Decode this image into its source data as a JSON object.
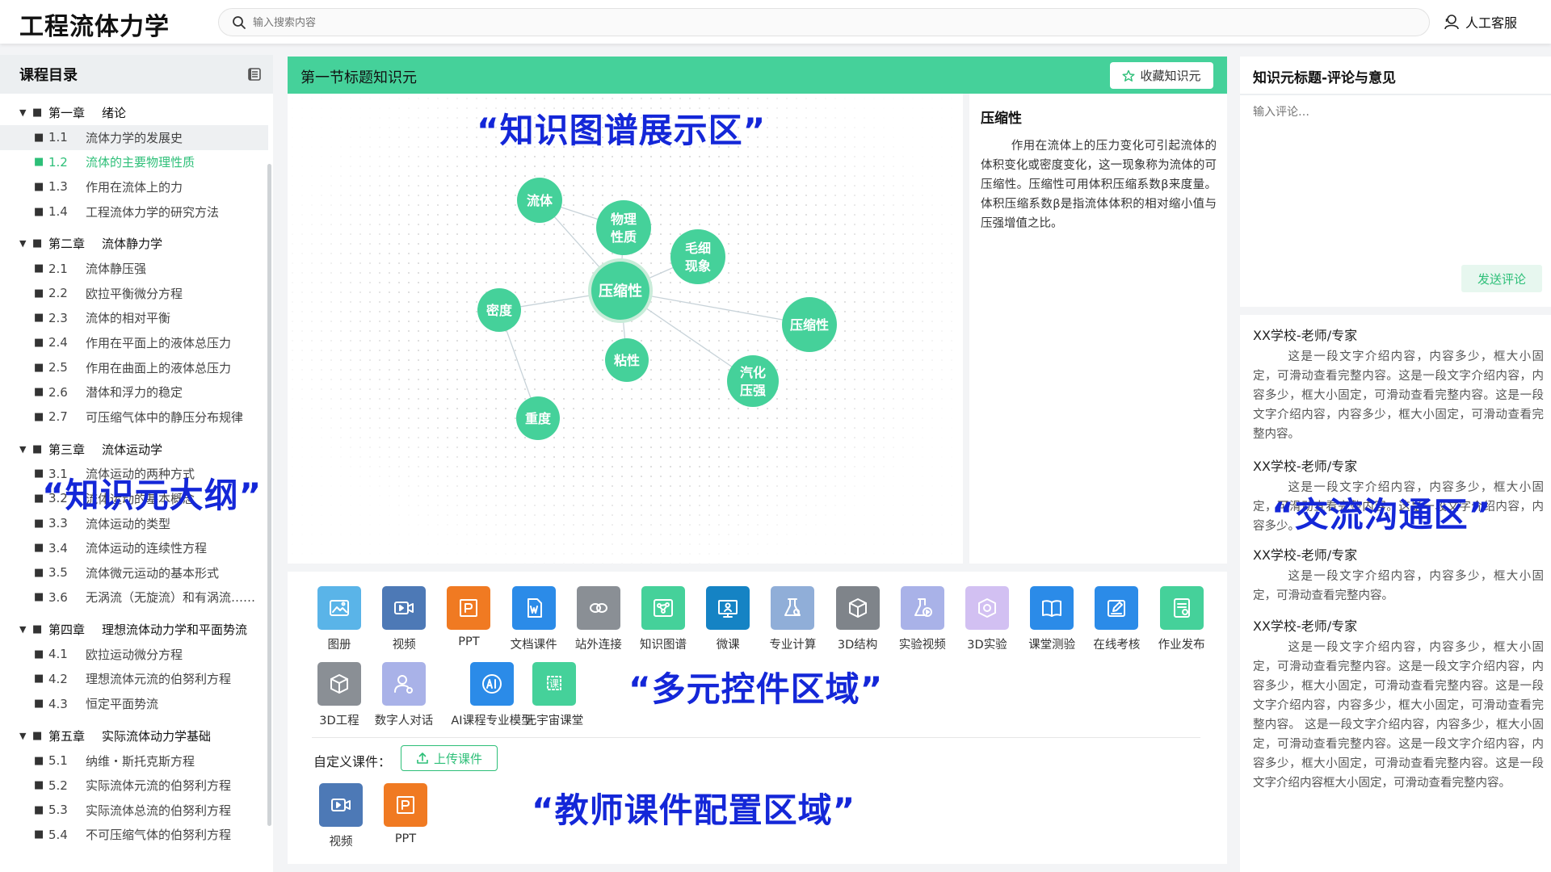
{
  "header": {
    "app_title": "工程流体力学",
    "search_placeholder": "输入搜索内容",
    "service_label": "人工客服"
  },
  "sidebar": {
    "title": "课程目录",
    "chapters": [
      {
        "no": "第一章",
        "title": "绪论",
        "sections": [
          {
            "no": "1.1",
            "title": "流体力学的发展史"
          },
          {
            "no": "1.2",
            "title": "流体的主要物理性质"
          },
          {
            "no": "1.3",
            "title": "作用在流体上的力"
          },
          {
            "no": "1.4",
            "title": "工程流体力学的研究方法"
          }
        ]
      },
      {
        "no": "第二章",
        "title": "流体静力学",
        "sections": [
          {
            "no": "2.1",
            "title": "流体静压强"
          },
          {
            "no": "2.2",
            "title": "欧拉平衡微分方程"
          },
          {
            "no": "2.3",
            "title": "流体的相对平衡"
          },
          {
            "no": "2.4",
            "title": "作用在平面上的液体总压力"
          },
          {
            "no": "2.5",
            "title": "作用在曲面上的液体总压力"
          },
          {
            "no": "2.6",
            "title": "潜体和浮力的稳定"
          },
          {
            "no": "2.7",
            "title": "可压缩气体中的静压分布规律"
          }
        ]
      },
      {
        "no": "第三章",
        "title": "流体运动学",
        "sections": [
          {
            "no": "3.1",
            "title": "流体运动的两种方式"
          },
          {
            "no": "3.2",
            "title": "流体运动的基本概念"
          },
          {
            "no": "3.3",
            "title": "流体运动的类型"
          },
          {
            "no": "3.4",
            "title": "流体运动的连续性方程"
          },
          {
            "no": "3.5",
            "title": "流体微元运动的基本形式"
          },
          {
            "no": "3.6",
            "title": "无涡流（无旋流）和有涡流……"
          }
        ]
      },
      {
        "no": "第四章",
        "title": "理想流体动力学和平面势流",
        "sections": [
          {
            "no": "4.1",
            "title": "欧拉运动微分方程"
          },
          {
            "no": "4.2",
            "title": "理想流体元流的伯努利方程"
          },
          {
            "no": "4.3",
            "title": "恒定平面势流"
          }
        ]
      },
      {
        "no": "第五章",
        "title": "实际流体动力学基础",
        "sections": [
          {
            "no": "5.1",
            "title": "纳维・斯托克斯方程"
          },
          {
            "no": "5.2",
            "title": "实际流体元流的伯努利方程"
          },
          {
            "no": "5.3",
            "title": "实际流体总流的伯努利方程"
          },
          {
            "no": "5.4",
            "title": "不可压缩气体的伯努利方程"
          }
        ]
      }
    ]
  },
  "center": {
    "title": "第一节标题知识元",
    "favorite_label": "收藏知识元",
    "graph_nodes": [
      "压缩性",
      "流体",
      "物理\n性质",
      "毛细\n现象",
      "密度",
      "粘性",
      "压缩性",
      "汽化\n压强",
      "重度"
    ],
    "detail_title": "压缩性",
    "detail_text": "作用在流体上的压力变化可引起流体的体积变化或密度变化，这一现象称为流体的可压缩性。压缩性可用体积压缩系数β来度量。体积压缩系数β是指流体体积的相对缩小值与压强增值之比。"
  },
  "tools": {
    "items": [
      {
        "label": "图册",
        "icon": "album-icon",
        "color": "#5ab4e8"
      },
      {
        "label": "视频",
        "icon": "video-icon",
        "color": "#4d79b6"
      },
      {
        "label": "PPT",
        "icon": "ppt-icon",
        "color": "#f07a22"
      },
      {
        "label": "文档课件",
        "icon": "word-doc-icon",
        "color": "#2b8be8"
      },
      {
        "label": "站外连接",
        "icon": "link-icon",
        "color": "#8a8f95"
      },
      {
        "label": "知识图谱",
        "icon": "knowledge-graph-icon",
        "color": "#45d19a"
      },
      {
        "label": "微课",
        "icon": "micro-lesson-icon",
        "color": "#1583c4"
      },
      {
        "label": "专业计算",
        "icon": "flask-icon",
        "color": "#90aed8"
      },
      {
        "label": "3D结构",
        "icon": "cube-icon",
        "color": "#7f848a"
      },
      {
        "label": "实验视频",
        "icon": "experiment-video-icon",
        "color": "#a9b2e8"
      },
      {
        "label": "3D实验",
        "icon": "3d-experiment-icon",
        "color": "#d2c0f2"
      },
      {
        "label": "课堂测验",
        "icon": "book-quiz-icon",
        "color": "#2b8be8"
      },
      {
        "label": "在线考核",
        "icon": "edit-icon",
        "color": "#2b8be8"
      },
      {
        "label": "作业发布",
        "icon": "homework-icon",
        "color": "#45d19a"
      },
      {
        "label": "3D工程",
        "icon": "3d-engineering-icon",
        "color": "#8a8f95"
      },
      {
        "label": "数字人对话",
        "icon": "digital-human-icon",
        "color": "#a9b2e8"
      },
      {
        "label": "AI课程专业模型",
        "icon": "ai-model-icon",
        "color": "#2b8be8"
      },
      {
        "label": "元宇宙课堂",
        "icon": "metaverse-icon",
        "color": "#45d19a"
      }
    ],
    "custom_label": "自定义课件：",
    "upload_label": "上传课件",
    "custom_items": [
      {
        "label": "视频",
        "icon": "video-icon",
        "color": "#4d79b6"
      },
      {
        "label": "PPT",
        "icon": "ppt-icon",
        "color": "#f07a22"
      }
    ]
  },
  "right": {
    "title": "知识元标题-评论与意见",
    "comment_placeholder": "输入评论…",
    "send_label": "发送评论",
    "comments": [
      {
        "author": "XX学校-老师/专家",
        "text": "这是一段文字介绍内容，内容多少，框大小固定，可滑动查看完整内容。这是一段文字介绍内容，内容多少，框大小固定，可滑动查看完整内容。这是一段文字介绍内容，内容多少，框大小固定，可滑动查看完整内容。"
      },
      {
        "author": "XX学校-老师/专家",
        "text": "这是一段文字介绍内容，内容多少，框大小固定，可滑动查看完整内容。这是一段文字介绍内容，内容多少。"
      },
      {
        "author": "XX学校-老师/专家",
        "text": "这是一段文字介绍内容，内容多少，框大小固定，可滑动查看完整内容。"
      },
      {
        "author": "XX学校-老师/专家",
        "text": "这是一段文字介绍内容，内容多少，框大小固定，可滑动查看完整内容。这是一段文字介绍内容，内容多少，框大小固定，可滑动查看完整内容。这是一段文字介绍内容，内容多少，框大小固定，可滑动查看完整内容。 这是一段文字介绍内容，内容多少，框大小固定，可滑动查看完整内容。这是一段文字介绍内容，内容多少，框大小固定，可滑动查看完整内容。这是一段文字介绍内容框大小固定，可滑动查看完整内容。"
      }
    ]
  },
  "overlays": {
    "graph": "“知识图谱展示区”",
    "outline": "“知识元大纲”",
    "controls": "“多元控件区域”",
    "teacher": "“教师课件配置区域”",
    "communication": "“交流沟通区”"
  },
  "colors": {
    "accent": "#45d19a",
    "accent_text": "#2dbf78",
    "overlay": "#1427d8"
  }
}
